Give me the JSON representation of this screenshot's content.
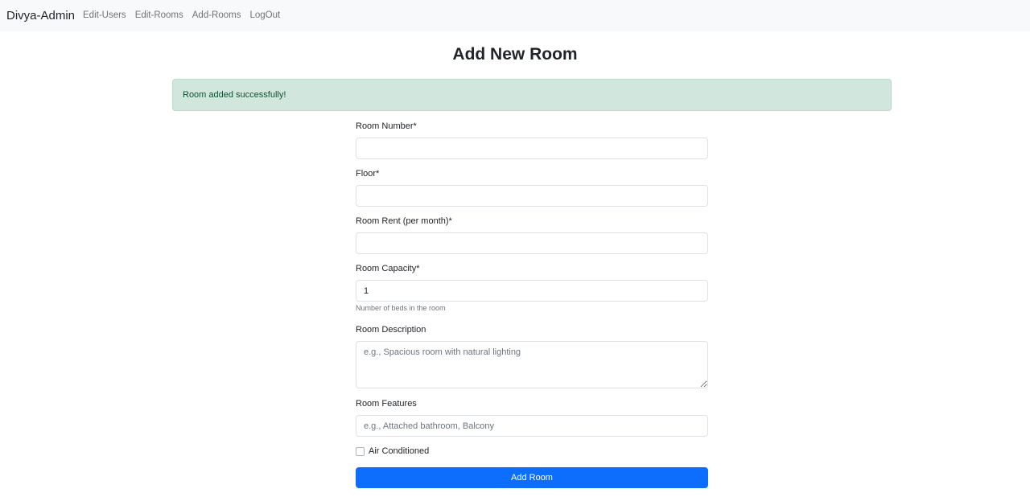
{
  "navbar": {
    "brand": "Divya-Admin",
    "links": [
      "Edit-Users",
      "Edit-Rooms",
      "Add-Rooms",
      "LogOut"
    ]
  },
  "page": {
    "title": "Add New Room",
    "alert": "Room added successfully!"
  },
  "form": {
    "room_number": {
      "label": "Room Number*",
      "value": ""
    },
    "floor": {
      "label": "Floor*",
      "value": ""
    },
    "room_rent": {
      "label": "Room Rent (per month)*",
      "value": ""
    },
    "room_capacity": {
      "label": "Room Capacity*",
      "value": "1",
      "help": "Number of beds in the room"
    },
    "room_description": {
      "label": "Room Description",
      "placeholder": "e.g., Spacious room with natural lighting"
    },
    "room_features": {
      "label": "Room Features",
      "placeholder": "e.g., Attached bathroom, Balcony"
    },
    "air_conditioned": {
      "label": "Air Conditioned",
      "checked": false
    },
    "submit_label": "Add Room"
  },
  "colors": {
    "navbar_bg": "#f8f9fa",
    "alert_bg": "#d1e7dd",
    "alert_text": "#0f5132",
    "primary": "#0d6efd"
  }
}
